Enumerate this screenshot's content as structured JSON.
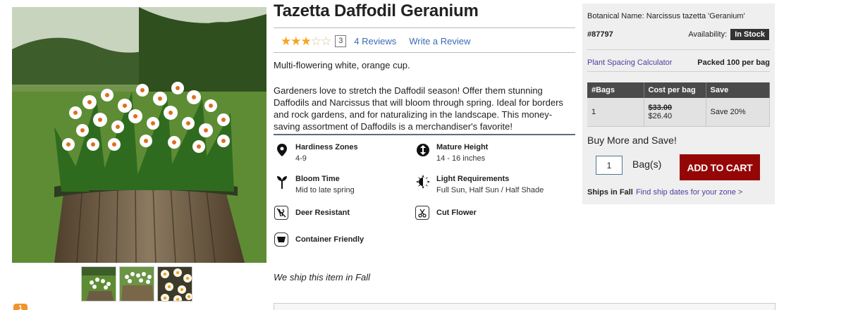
{
  "product": {
    "title": "Tazetta Daffodil Geranium",
    "rating_stars": 3,
    "rating_max": 5,
    "review_count": "3",
    "reviews_link": "4 Reviews",
    "write_review_link": "Write a Review",
    "short_description": "Multi-flowering white, orange cup.",
    "long_description": "Gardeners love to stretch the Daffodil season! Offer them stunning Daffodils and Narcissus that will bloom through spring. Ideal for borders and rock gardens, and for naturalizing in the landscape. This money-saving assortment of Daffodils is a merchandiser's favorite!",
    "ship_note": "We ship this item in Fall"
  },
  "features": {
    "hardiness": {
      "title": "Hardiness Zones",
      "value": "4-9",
      "icon": "map-pin-icon"
    },
    "height": {
      "title": "Mature Height",
      "value": "14 - 16 inches",
      "icon": "height-icon"
    },
    "bloom": {
      "title": "Bloom Time",
      "value": "Mid to late spring",
      "icon": "sprout-icon"
    },
    "light": {
      "title": "Light Requirements",
      "value": "Full Sun, Half Sun / Half Shade",
      "icon": "sun-icon"
    },
    "deer": {
      "title": "Deer Resistant",
      "icon": "deer-resistant-icon"
    },
    "cut": {
      "title": "Cut Flower",
      "icon": "cut-flower-icon"
    },
    "container": {
      "title": "Container Friendly",
      "icon": "container-icon"
    }
  },
  "panel": {
    "botanical": "Botanical Name: Narcissus tazetta 'Geranium'",
    "sku": "#87797",
    "availability_label": "Availability:",
    "availability_value": "In Stock",
    "calc_link": "Plant Spacing Calculator",
    "packed": "Packed 100 per bag",
    "table_headers": [
      "#Bags",
      "Cost per bag",
      "Save"
    ],
    "table_row": {
      "bags": "1",
      "old_price": "$33.00",
      "new_price": "$26.40",
      "save": "Save 20%"
    },
    "buy_more": "Buy More and Save!",
    "qty_value": "1",
    "bags_label": "Bag(s)",
    "add_to_cart": "ADD TO CART",
    "ships": "Ships in Fall",
    "ship_link": "Find ship dates for your zone >"
  },
  "badge": "1",
  "colors": {
    "add_to_cart": "#950707",
    "link_blue": "#3a6bb5",
    "link_purple": "#4d3e9e",
    "star": "#f5a623",
    "table_header": "#4a4a4a"
  }
}
